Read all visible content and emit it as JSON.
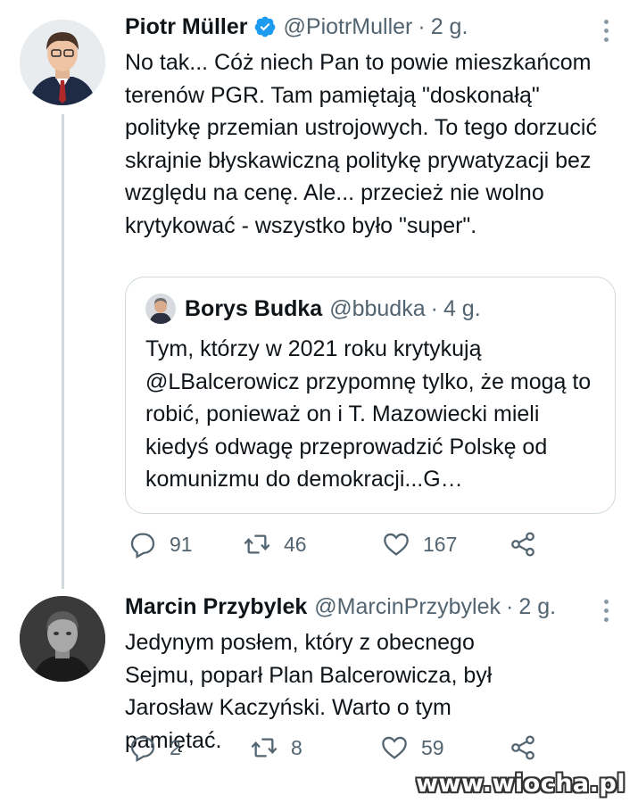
{
  "tweets": [
    {
      "name": "Piotr Müller",
      "handle": "@PiotrMuller",
      "separator": "·",
      "time": "2 g.",
      "verified": true,
      "text": "No tak... Cóż niech Pan to powie mieszkańcom terenów PGR. Tam pamiętają \"doskonałą\" politykę przemian ustrojowych. To tego dorzucić skrajnie błyskawiczną politykę prywatyzacji bez względu na cenę. Ale... przecież nie wolno krytykować - wszystko było \"super\".",
      "quote": {
        "name": "Borys Budka",
        "handle": "@bbudka",
        "separator": "·",
        "time": "4 g.",
        "text": "Tym, którzy w 2021 roku krytykują @LBalcerowicz przypomnę tylko, że mogą to robić, ponieważ on i T. Mazowiecki mieli kiedyś odwagę przeprowadzić Polskę od komunizmu do demokracji...G…"
      },
      "replies": "91",
      "retweets": "46",
      "likes": "167"
    },
    {
      "name": "Marcin Przybylek",
      "handle": "@MarcinPrzybylek",
      "separator": "·",
      "time": "2 g.",
      "text": "Jedynym posłem, który z obecnego Sejmu, poparł Plan Balcerowicza, był Jarosław Kaczyński. Warto o tym pamiętać.",
      "replies": "2",
      "retweets": "8",
      "likes": "59"
    }
  ],
  "watermark": "www.wiocha.pl",
  "colors": {
    "text": "#0f1419",
    "secondary": "#536471",
    "verified": "#1d9bf0",
    "border": "#cfd9de"
  },
  "icons": [
    "verified-badge-icon",
    "more-icon",
    "reply-icon",
    "retweet-icon",
    "like-icon",
    "share-icon"
  ]
}
